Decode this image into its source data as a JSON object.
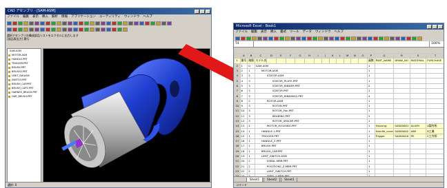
{
  "cad": {
    "title": "CAD アセンブリ - [SAM-ASM]",
    "menu": [
      "ファイル",
      "編集",
      "表示",
      "挿入",
      "解析",
      "情報",
      "アプリケーション",
      "ユーティリティ",
      "ウィンドウ",
      "ヘルプ"
    ],
    "info_lines": [
      "選択アセンブリの構成部品リストをエクセルに出力します",
      "[部品表出力] 実行"
    ],
    "tree": [
      "SAM.ASM",
      "MOTOR.ASM",
      "HANDLE.PRT",
      "TRIGGER.PRT",
      "BRUSH.PRT",
      "BRUSH2.PRT",
      "LIMIT_SW.ASM",
      "SWITCH.PRT",
      "BRUSH_CAP.PRT",
      "BRUSH_CAP2.PRT",
      "HARNES_BRUSH.PRT",
      "HAR_BRUSH.PRT"
    ],
    "status": "選択: 0"
  },
  "excel": {
    "title": "Microsoft Excel - Book1",
    "menu": [
      "ファイル",
      "編集",
      "表示",
      "挿入",
      "書式",
      "ツール",
      "データ",
      "ウィンドウ",
      "ヘルプ"
    ],
    "name_box": "T4",
    "zoom": "100%",
    "columns": [
      "",
      "A",
      "B",
      "C",
      "D",
      "E",
      "F",
      "G",
      "H",
      "I",
      "J",
      "K",
      "L",
      "M",
      "N",
      "O",
      "P",
      "Q",
      "R",
      "S",
      "T"
    ],
    "header_row": [
      "1",
      "番号",
      "階層",
      "モデル名称",
      "",
      "",
      "",
      "",
      "",
      "",
      "",
      "",
      "",
      "",
      "",
      "",
      "員数",
      "PART_NAME",
      "DRAW_NO",
      "MATERIAL",
      "PURCHASE"
    ],
    "rows": [
      [
        "2",
        "1",
        "0",
        "SAM.ASM",
        "1",
        "",
        "",
        "",
        ""
      ],
      [
        "3",
        "2",
        "1",
        "MOTOR.ASM",
        "1",
        "",
        "",
        "",
        ""
      ],
      [
        "4",
        "3",
        "2",
        "STATOR.ASM",
        "1",
        "",
        "",
        "",
        ""
      ],
      [
        "5",
        "4",
        "3",
        "STATOR_PLATE.PRT",
        "1",
        "",
        "",
        "",
        ""
      ],
      [
        "6",
        "5",
        "3",
        "STATOR_BINDER.PRT",
        "2",
        "",
        "",
        "",
        ""
      ],
      [
        "7",
        "6",
        "3",
        "STATOR.PRT",
        "1",
        "",
        "",
        "",
        ""
      ],
      [
        "8",
        "7",
        "3",
        "STATOR_BINDING2.PRT",
        "4",
        "",
        "",
        "",
        ""
      ],
      [
        "9",
        "8",
        "2",
        "ROTOR.ASM",
        "1",
        "",
        "",
        "",
        ""
      ],
      [
        "10",
        "9",
        "3",
        "ROTOR.PRT",
        "1",
        "",
        "",
        "",
        ""
      ],
      [
        "11",
        "10",
        "3",
        "ROTOR_Fan.PRT",
        "1",
        "",
        "",
        "",
        ""
      ],
      [
        "12",
        "11",
        "3",
        "BEARING.PRT",
        "2",
        "",
        "",
        "",
        ""
      ],
      [
        "13",
        "12",
        "3",
        "ROTOR_SPACER.PRT",
        "1",
        "",
        "",
        "",
        ""
      ],
      [
        "14",
        "13",
        "2",
        "MOTOR_HOUSING.PRT",
        "1",
        "Housing",
        "SA000001",
        "ALUMI",
        "A製作所"
      ],
      [
        "15",
        "14",
        "1",
        "HANDLE.1.PRT",
        "1",
        "Handle_cover",
        "SA000002",
        "ABS",
        "B工業"
      ],
      [
        "16",
        "15",
        "1",
        "TRIGGER.PRT",
        "1",
        "Trigger",
        "SA000010",
        "PE",
        "C工作所"
      ],
      [
        "17",
        "16",
        "1",
        "HANDLE_2.PRT",
        "1",
        "",
        "",
        "",
        ""
      ],
      [
        "18",
        "17",
        "1",
        "BRUSH.PRT",
        "1",
        "",
        "",
        "",
        ""
      ],
      [
        "19",
        "18",
        "1",
        "BRUSH_CAP.PRT",
        "1",
        "",
        "",
        "",
        ""
      ],
      [
        "20",
        "19",
        "1",
        "LIMIT_SWITCH.ASM",
        "1",
        "",
        "",
        "",
        ""
      ],
      [
        "21",
        "20",
        "2",
        "XSBAL.MBR.PRT",
        "1",
        "",
        "",
        "",
        ""
      ],
      [
        "22",
        "21",
        "2",
        "POSITION2_Z.MBR.PRT",
        "1",
        "",
        "",
        "",
        ""
      ],
      [
        "23",
        "22",
        "2",
        "LIMIT_SWITCH.PRT",
        "1",
        "",
        "",
        "",
        ""
      ],
      [
        "24",
        "23",
        "2",
        "SPEN_2.MBR.PRT",
        "1",
        "",
        "",
        "",
        ""
      ],
      [
        "25",
        "24",
        "1",
        "HARNES_BRUSH.PRT",
        "1",
        "",
        "",
        "",
        ""
      ],
      [
        "26",
        "25",
        "1",
        "HAR_BRUSH.PRT",
        "1",
        "",
        "",
        "",
        ""
      ],
      [
        "27",
        "26",
        "1",
        "HAR_BRUSH_2.PRT",
        "1",
        "",
        "",
        "",
        ""
      ]
    ],
    "sheet_tabs": [
      "Sheet1",
      "Sheet2",
      "Sheet3"
    ],
    "status": "コマンド"
  },
  "colors": {
    "model_blue": "#1f3fd0",
    "arrow_red": "#e01818",
    "viewport_bg": "#000000"
  }
}
